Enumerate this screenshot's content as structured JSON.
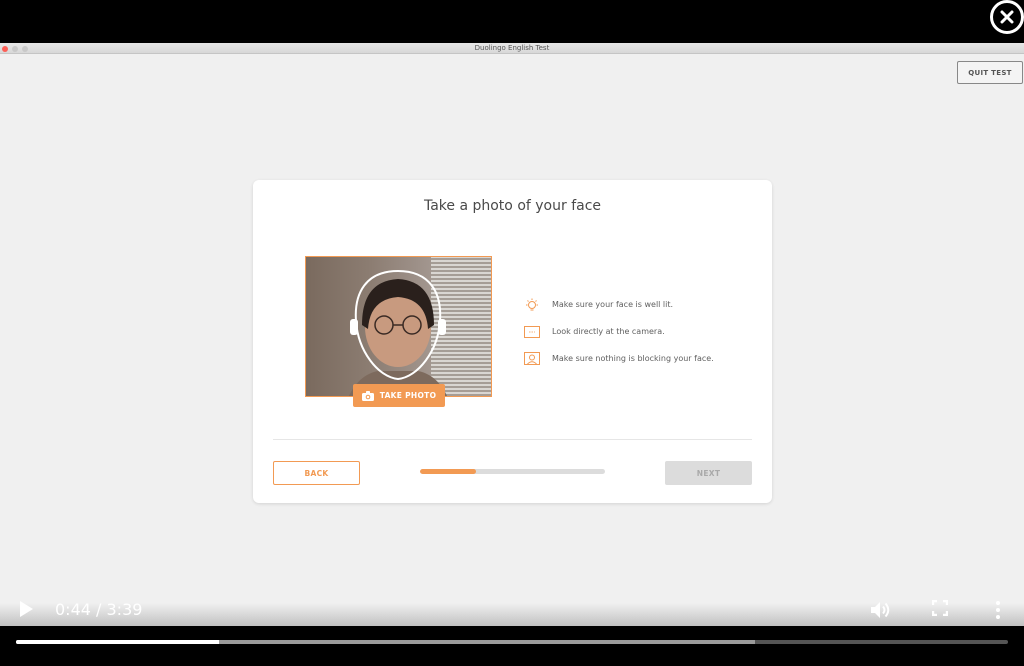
{
  "window": {
    "title": "Duolingo English Test"
  },
  "header": {
    "quit_label": "QUIT TEST"
  },
  "card": {
    "title": "Take a photo of your face",
    "take_photo_label": "TAKE PHOTO",
    "tips": [
      {
        "icon": "lightbulb-icon",
        "text": "Make sure your face is well lit."
      },
      {
        "icon": "camera-frame-icon",
        "text": "Look directly at the camera."
      },
      {
        "icon": "face-frame-icon",
        "text": "Make sure nothing is blocking your face."
      }
    ],
    "back_label": "BACK",
    "next_label": "NEXT",
    "progress": 0.3
  },
  "player": {
    "current_time": "0:44",
    "duration": "3:39",
    "time_display": "0:44 / 3:39",
    "played_fraction": 0.205,
    "buffered_fraction": 0.745
  },
  "colors": {
    "accent": "#f29a53",
    "disabled": "#dcdcdc"
  }
}
